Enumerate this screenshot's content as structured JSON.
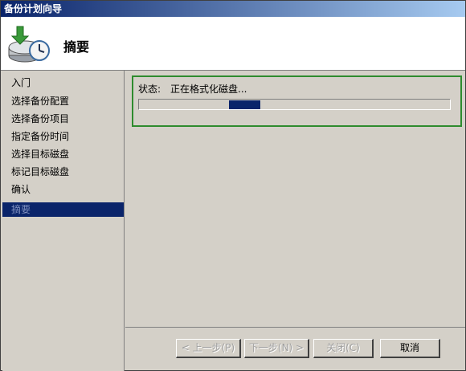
{
  "window": {
    "title": "备份计划向导"
  },
  "header": {
    "title": "摘要",
    "icon": "backup-clock-icon"
  },
  "steps": [
    {
      "label": "入门"
    },
    {
      "label": "选择备份配置"
    },
    {
      "label": "选择备份项目"
    },
    {
      "label": "指定备份时间"
    },
    {
      "label": "选择目标磁盘"
    },
    {
      "label": "标记目标磁盘"
    },
    {
      "label": "确认"
    },
    {
      "label": "摘要",
      "active": true
    }
  ],
  "status": {
    "label": "状态:",
    "value": "正在格式化磁盘..."
  },
  "progress": {
    "marquee": true,
    "segment_start_fraction": 0.29,
    "segment_width_fraction": 0.1
  },
  "buttons": {
    "back": "< 上一步(P)",
    "next": "下一步(N) >",
    "close": "关闭(C)",
    "cancel": "取消"
  },
  "colors": {
    "accent": "#0a246a",
    "group_border": "#2e8b2e"
  }
}
